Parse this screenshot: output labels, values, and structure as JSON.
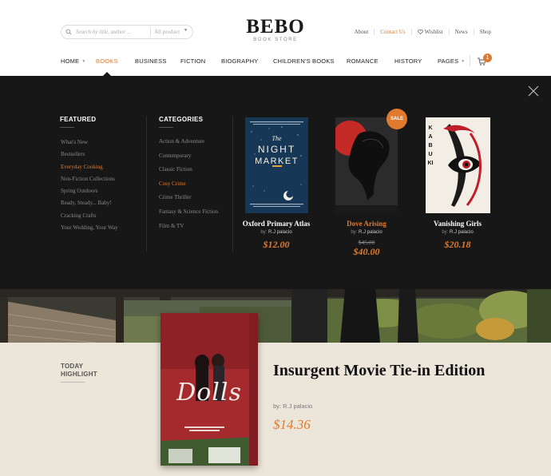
{
  "header": {
    "search_placeholder": "Search by title, author ...",
    "search_category": "All product",
    "logo_main": "BEBO",
    "logo_sub": "BOOK STORE",
    "links": [
      "About",
      "Contact Us",
      "Wishlist",
      "News",
      "Shop"
    ],
    "cart_count": "1"
  },
  "nav": {
    "items": [
      "HOME",
      "BOOKS",
      "BUSINESS",
      "FICTION",
      "BIOGRAPHY",
      "CHILDREN'S BOOKS",
      "ROMANCE",
      "HISTORY",
      "PAGES"
    ]
  },
  "mega": {
    "featured": {
      "title": "FEATURED",
      "items": [
        "What's New",
        "Bestsellers",
        "Everyday Cooking",
        "Non-Fiction Collections",
        "Spring Outdoors",
        "Ready, Steady... Baby!",
        "Cracking Crafts",
        "Your Wedding, Your Way"
      ]
    },
    "categories": {
      "title": "CATEGORIES",
      "items": [
        "Action & Adventure",
        "Contemporary",
        "Classic Fiction",
        "Cosy Crime",
        "Crime Thriller",
        "Fantasy & Science Fiction",
        "Film & TV"
      ]
    },
    "books": [
      {
        "title": "Oxford Primary Atlas",
        "author_prefix": "by:",
        "author": "R.J palacio",
        "price": "$12.00",
        "cover_line1": "The",
        "cover_line2": "NIGHT",
        "cover_line3": "MARKET"
      },
      {
        "title": "Dove Arising",
        "author_prefix": "by:",
        "author": "R.J palacio",
        "old_price": "$45.00",
        "price": "$40.00",
        "badge": "SALE"
      },
      {
        "title": "Vanishing Girls",
        "author_prefix": "by:",
        "author": "R.J palacio",
        "price": "$20.18",
        "cover_text": "KABUKI"
      }
    ]
  },
  "highlight": {
    "label_line1": "TODAY",
    "label_line2": "HIGHLIGHT",
    "cover_text": "Dolls",
    "title": "Insurgent Movie Tie-in Edition",
    "author_prefix": "by:",
    "author": "R.J palacio",
    "price": "$14.36"
  },
  "colors": {
    "accent": "#e07a2f",
    "mega_bg": "#171717",
    "highlight_bg": "#ece6da"
  }
}
